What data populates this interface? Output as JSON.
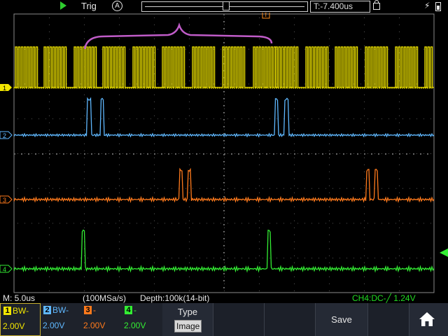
{
  "status": {
    "run_state_icon": "play-icon",
    "trigger_label": "Trig",
    "trigger_mode_glyph": "A",
    "trigger_time": "T:-7.400us",
    "lock_icon": "lock-icon",
    "usb_glyph": "⚡",
    "battery_icon": "battery-icon"
  },
  "markers": {
    "trigger_marker_glyph": "T",
    "ch1_glyph": "1",
    "ch2_glyph": "2",
    "ch3_glyph": "3",
    "ch4_glyph": "4"
  },
  "measurement": {
    "timebase": "M: 5.0us",
    "sample_rate": "(100MSa/s)",
    "depth": "Depth:100k(14-bit)",
    "trigger_info": "CH4:DC-╱  1.24V"
  },
  "channels": [
    {
      "num": "1",
      "bw": "BW-",
      "volts": "2.00V",
      "color": "#f2e600"
    },
    {
      "num": "2",
      "bw": "BW-",
      "volts": "2.00V",
      "color": "#5fb8ff"
    },
    {
      "num": "3",
      "bw": "-",
      "volts": "2.00V",
      "color": "#ff7a1c"
    },
    {
      "num": "4",
      "bw": "-",
      "volts": "2.00V",
      "color": "#33ee33"
    }
  ],
  "menu": {
    "type_title": "Type",
    "type_value": "Image",
    "save_label": "Save",
    "home_icon": "home-icon"
  },
  "colors": {
    "ch1": "#f2e600",
    "ch2": "#5fb8ff",
    "ch3": "#ff7a1c",
    "ch4": "#33ee33",
    "annotation": "#c05cc8",
    "grid": "#555555"
  }
}
